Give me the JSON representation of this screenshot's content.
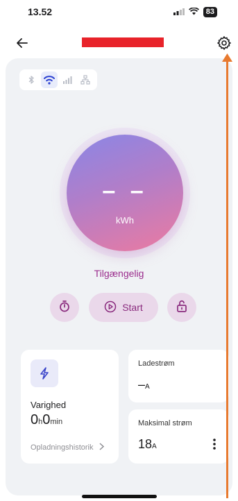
{
  "status_bar": {
    "time": "13.52",
    "battery": "83"
  },
  "app_bar": {
    "title_redacted": true
  },
  "connectivity": {
    "items": [
      "bluetooth-icon",
      "wifi-icon",
      "cellular-icon",
      "ethernet-icon"
    ],
    "active": "wifi-icon"
  },
  "meter": {
    "value": "– –",
    "unit": "kWh"
  },
  "status_text": "Tilgængelig",
  "controls": {
    "start_label": "Start"
  },
  "duration_card": {
    "label": "Varighed",
    "hours": "0",
    "hours_unit": "h",
    "minutes": "0",
    "minutes_unit": "min",
    "history_link": "Opladningshistorik"
  },
  "current_card": {
    "label": "Ladestrøm",
    "value": "–",
    "unit": "A"
  },
  "max_current_card": {
    "label": "Maksimal strøm",
    "value": "18",
    "unit": "A"
  },
  "colors": {
    "accent": "#9a2b8c",
    "annotation": "#e87a2f",
    "redaction": "#e8232a"
  }
}
